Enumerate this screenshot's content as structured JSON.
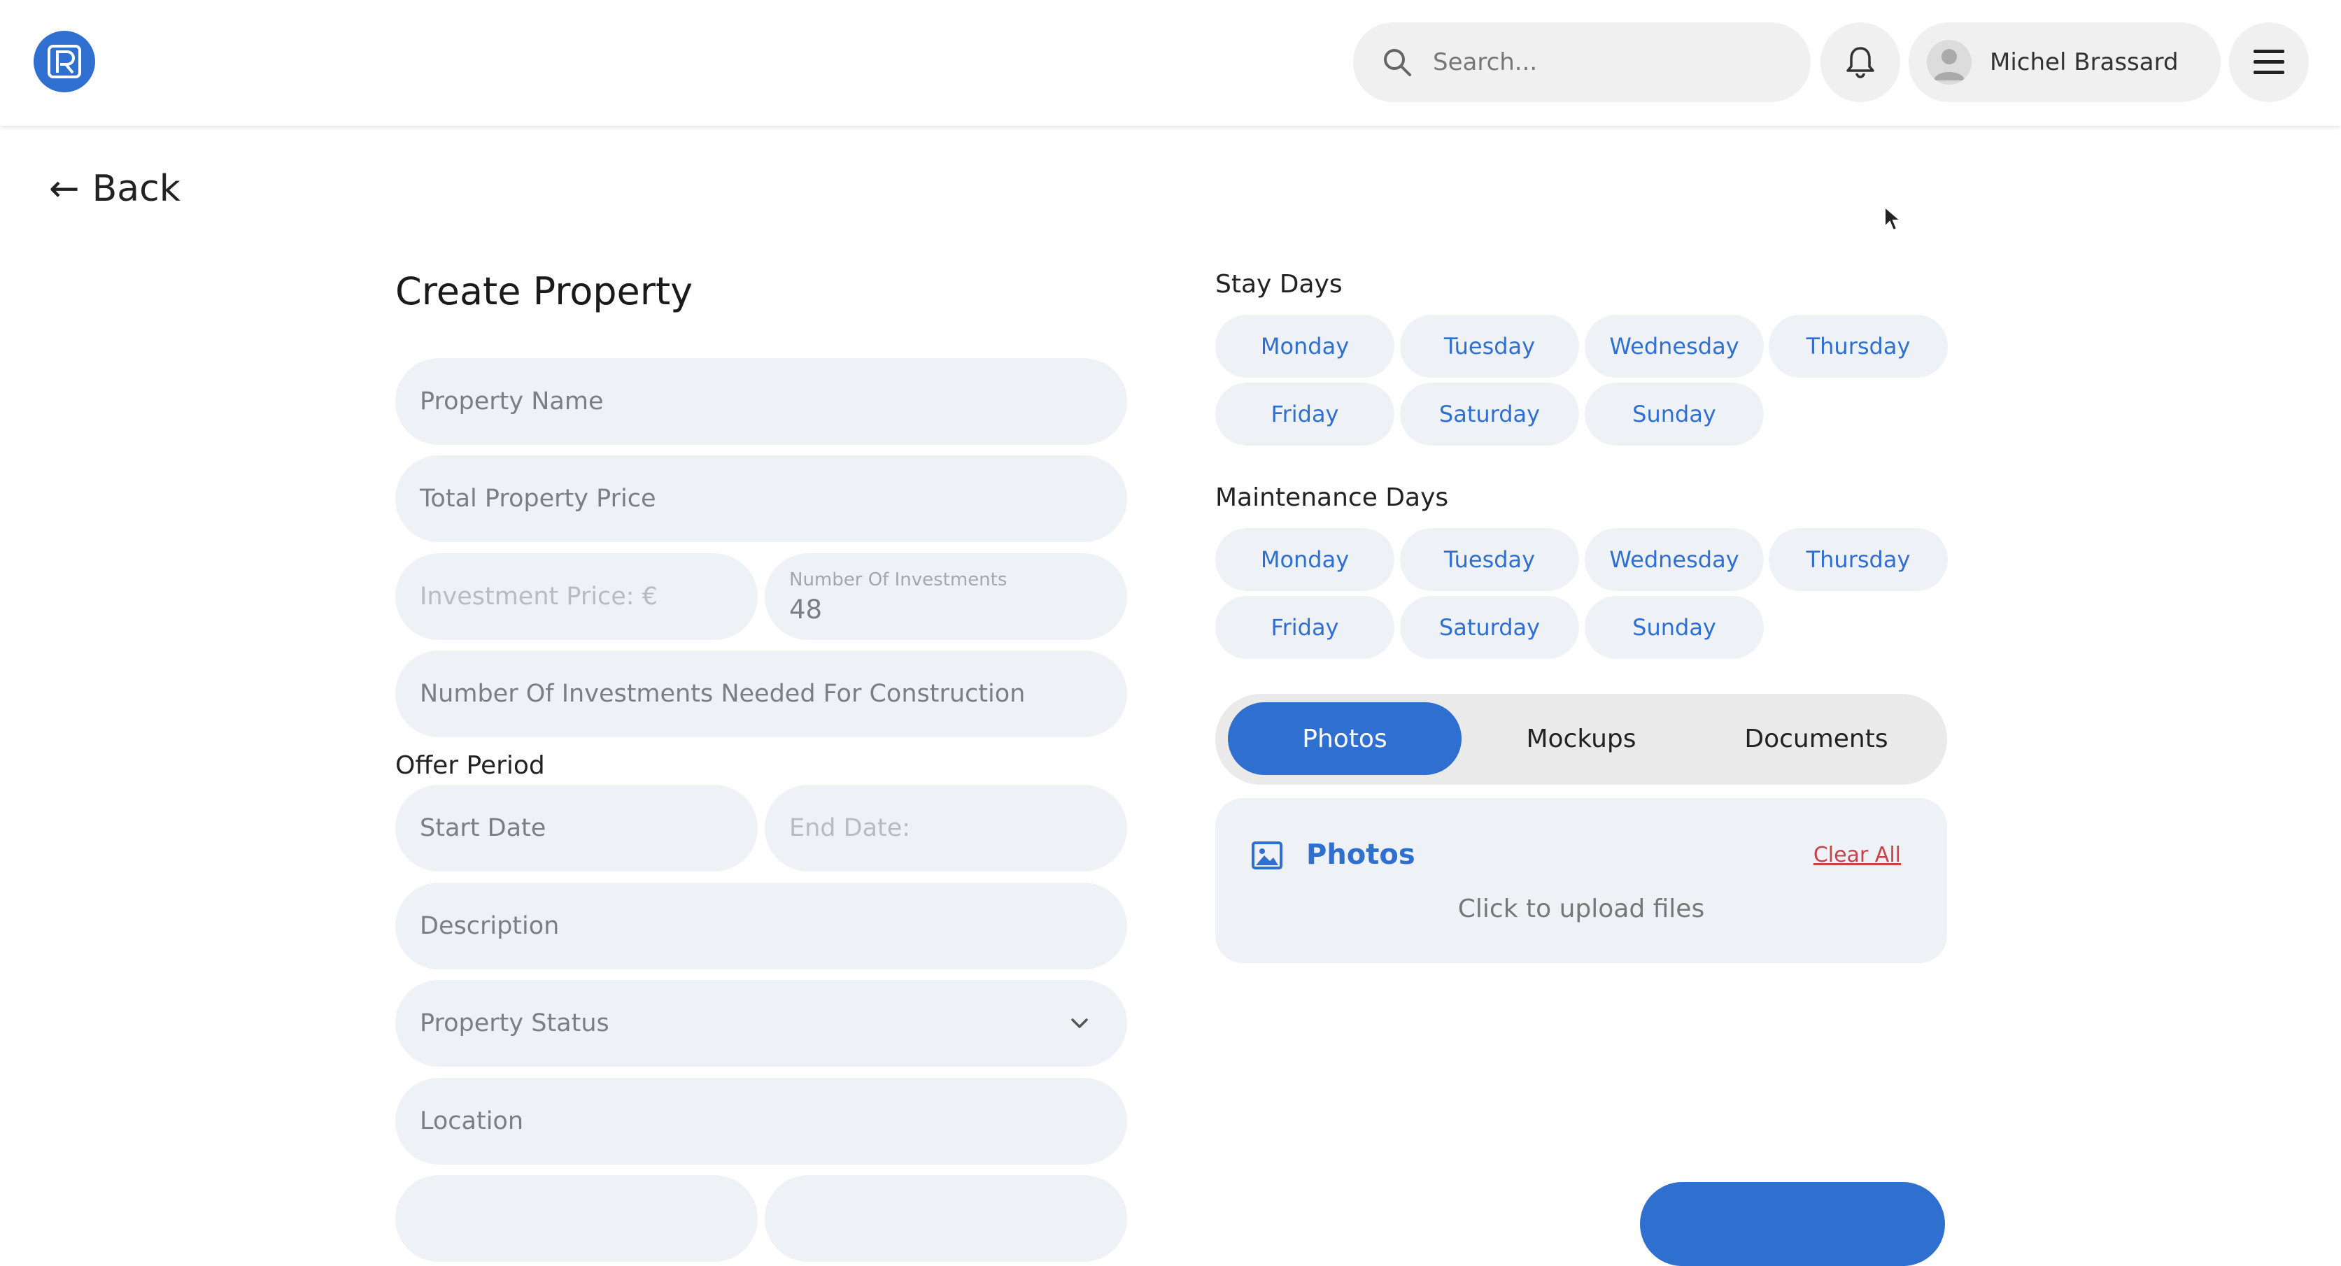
{
  "header": {
    "search_placeholder": "Search...",
    "user_name": "Michel Brassard"
  },
  "nav": {
    "back_label": "Back"
  },
  "form": {
    "title": "Create Property",
    "property_name_placeholder": "Property Name",
    "total_price_placeholder": "Total Property Price",
    "investment_price_placeholder": "Investment Price: €",
    "num_investments_label": "Number Of Investments",
    "num_investments_value": "48",
    "investments_needed_placeholder": "Number Of Investments Needed For Construction",
    "offer_period_label": "Offer Period",
    "start_date_placeholder": "Start Date",
    "end_date_placeholder": "End Date:",
    "description_placeholder": "Description",
    "property_status_placeholder": "Property Status",
    "location_placeholder": "Location"
  },
  "stay_days": {
    "label": "Stay Days",
    "days": [
      "Monday",
      "Tuesday",
      "Wednesday",
      "Thursday",
      "Friday",
      "Saturday",
      "Sunday"
    ]
  },
  "maintenance_days": {
    "label": "Maintenance Days",
    "days": [
      "Monday",
      "Tuesday",
      "Wednesday",
      "Thursday",
      "Friday",
      "Saturday",
      "Sunday"
    ]
  },
  "media_tabs": {
    "tabs": [
      "Photos",
      "Mockups",
      "Documents"
    ],
    "active": "Photos"
  },
  "upload": {
    "title": "Photos",
    "clear_label": "Clear All",
    "hint": "Click to upload files"
  },
  "colors": {
    "accent": "#2f6fd0",
    "field_bg": "#eef2f6",
    "danger": "#c9424a"
  }
}
